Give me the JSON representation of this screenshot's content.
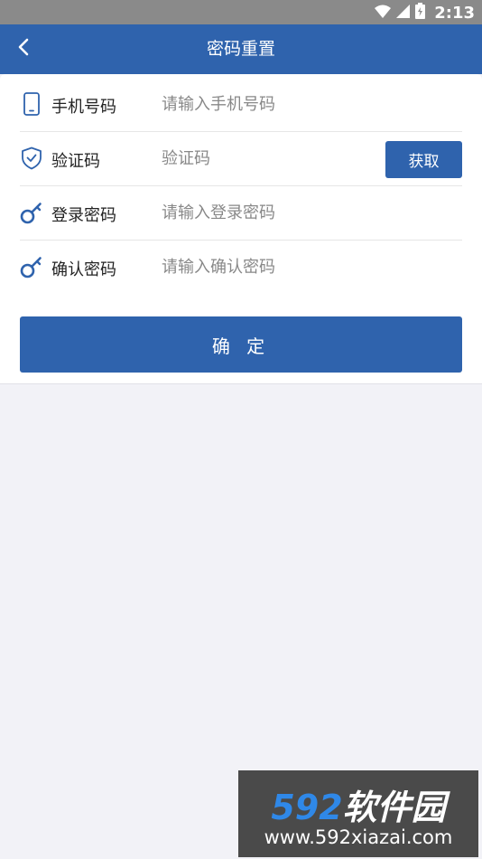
{
  "status_bar": {
    "time": "2:13",
    "icons": [
      "wifi-icon",
      "signal-icon",
      "battery-icon"
    ]
  },
  "header": {
    "title": "密码重置",
    "back_icon": "chevron-left-icon"
  },
  "form": {
    "rows": [
      {
        "icon": "phone-icon",
        "label": "手机号码",
        "placeholder": "请输入手机号码",
        "value": ""
      },
      {
        "icon": "shield-check-icon",
        "label": "验证码",
        "placeholder": "验证码",
        "value": "",
        "action_label": "获取"
      },
      {
        "icon": "key-icon",
        "label": "登录密码",
        "placeholder": "请输入登录密码",
        "value": ""
      },
      {
        "icon": "key-icon",
        "label": "确认密码",
        "placeholder": "请输入确认密码",
        "value": ""
      }
    ],
    "submit_label": "确 定"
  },
  "watermark": {
    "logo_number": "592",
    "logo_text": "软件园",
    "url": "www.592xiazai.com"
  },
  "colors": {
    "primary": "#2f63ad",
    "background": "#f2f2f7",
    "status_bar": "#8a8a8a"
  }
}
